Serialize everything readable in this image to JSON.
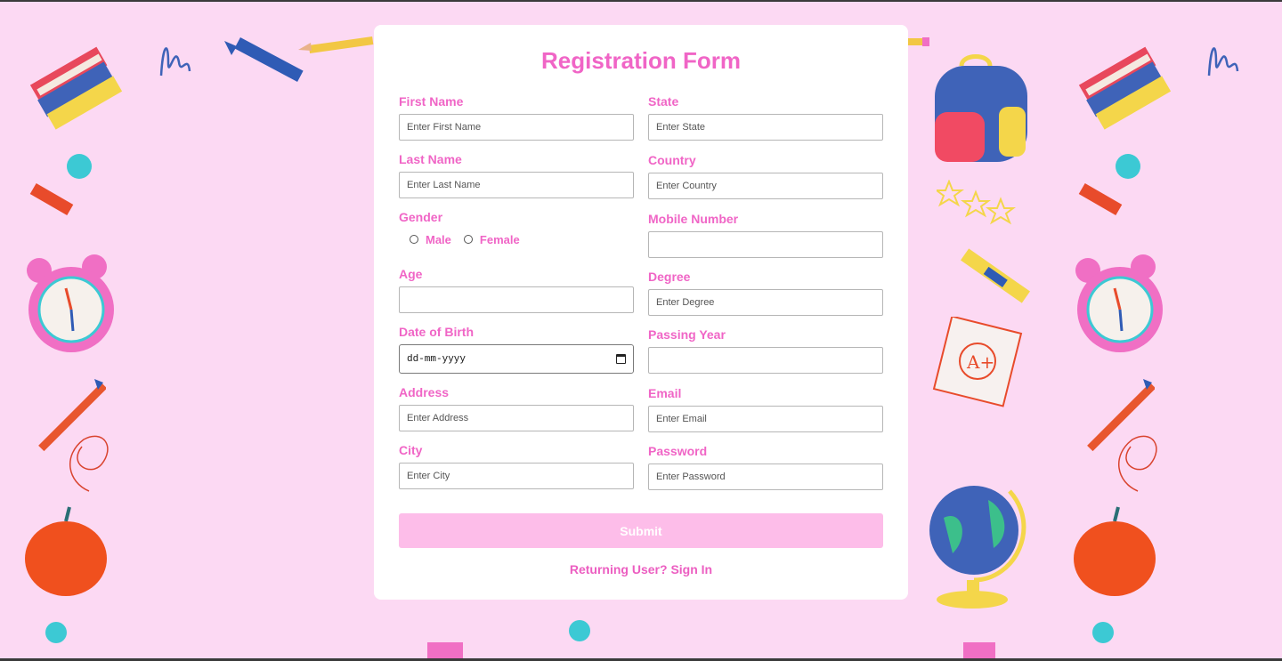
{
  "form": {
    "title": "Registration Form",
    "left_fields": [
      {
        "label": "First Name",
        "placeholder": "Enter First Name"
      },
      {
        "label": "Last Name",
        "placeholder": "Enter Last Name"
      }
    ],
    "gender": {
      "label": "Gender",
      "options": [
        "Male",
        "Female"
      ]
    },
    "age": {
      "label": "Age",
      "placeholder": ""
    },
    "dob": {
      "label": "Date of Birth",
      "value": "dd-mm-yyyy"
    },
    "address": {
      "label": "Address",
      "placeholder": "Enter Address"
    },
    "city": {
      "label": "City",
      "placeholder": "Enter City"
    },
    "right_fields": [
      {
        "label": "State",
        "placeholder": "Enter State"
      },
      {
        "label": "Country",
        "placeholder": "Enter Country"
      },
      {
        "label": "Mobile Number",
        "placeholder": ""
      },
      {
        "label": "Degree",
        "placeholder": "Enter Degree"
      },
      {
        "label": "Passing Year",
        "placeholder": ""
      },
      {
        "label": "Email",
        "placeholder": "Enter Email"
      },
      {
        "label": "Password",
        "placeholder": "Enter Password"
      }
    ],
    "submit_label": "Submit",
    "signin_text": "Returning User? Sign In"
  },
  "colors": {
    "background": "#fcd9f3",
    "accent": "#f065c6",
    "submit": "#fdbde9"
  },
  "decorations": [
    "books-icon",
    "crayon-icon",
    "pencil-icon",
    "alarm-clock-icon",
    "apple-icon",
    "backpack-icon",
    "stars-icon",
    "notepad-icon",
    "globe-icon",
    "scribble-icon"
  ]
}
